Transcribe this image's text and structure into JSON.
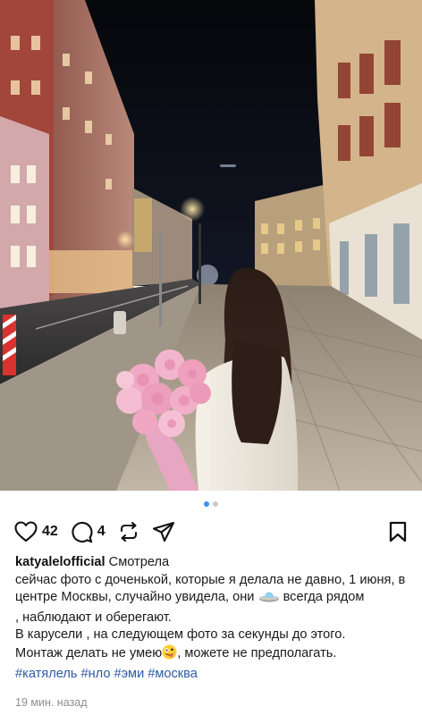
{
  "post": {
    "image_alt": "",
    "carousel": {
      "total": 2,
      "current": 1
    }
  },
  "actions": {
    "like_count": "42",
    "comment_count": "4"
  },
  "caption": {
    "username": "katyalelofficial",
    "line1": "Смотрела",
    "line2": "сейчас фото с доченькой, которые я делала не давно, 1 июня, в центре Москвы, случайно увидела, они",
    "line2b": "всегда рядом",
    "line3": ", наблюдают и оберегают.",
    "line4": "В карусели , на следующем фото за секунды до этого.",
    "line5a": "Монтаж делать не умею",
    "line5b": ", можете не предполагать.",
    "hashtags": [
      "#катялель",
      "#нло",
      "#эми",
      "#москва"
    ]
  },
  "timestamp": "19 мин. назад",
  "icons": [
    "heart-icon",
    "comment-icon",
    "repost-icon",
    "share-icon",
    "bookmark-icon",
    "ufo-emoji-icon",
    "zany-face-emoji-icon"
  ],
  "colors": {
    "accent_dot": "#3897f0",
    "hashtag": "#2f5aa3",
    "muted": "#8e8e8e"
  }
}
